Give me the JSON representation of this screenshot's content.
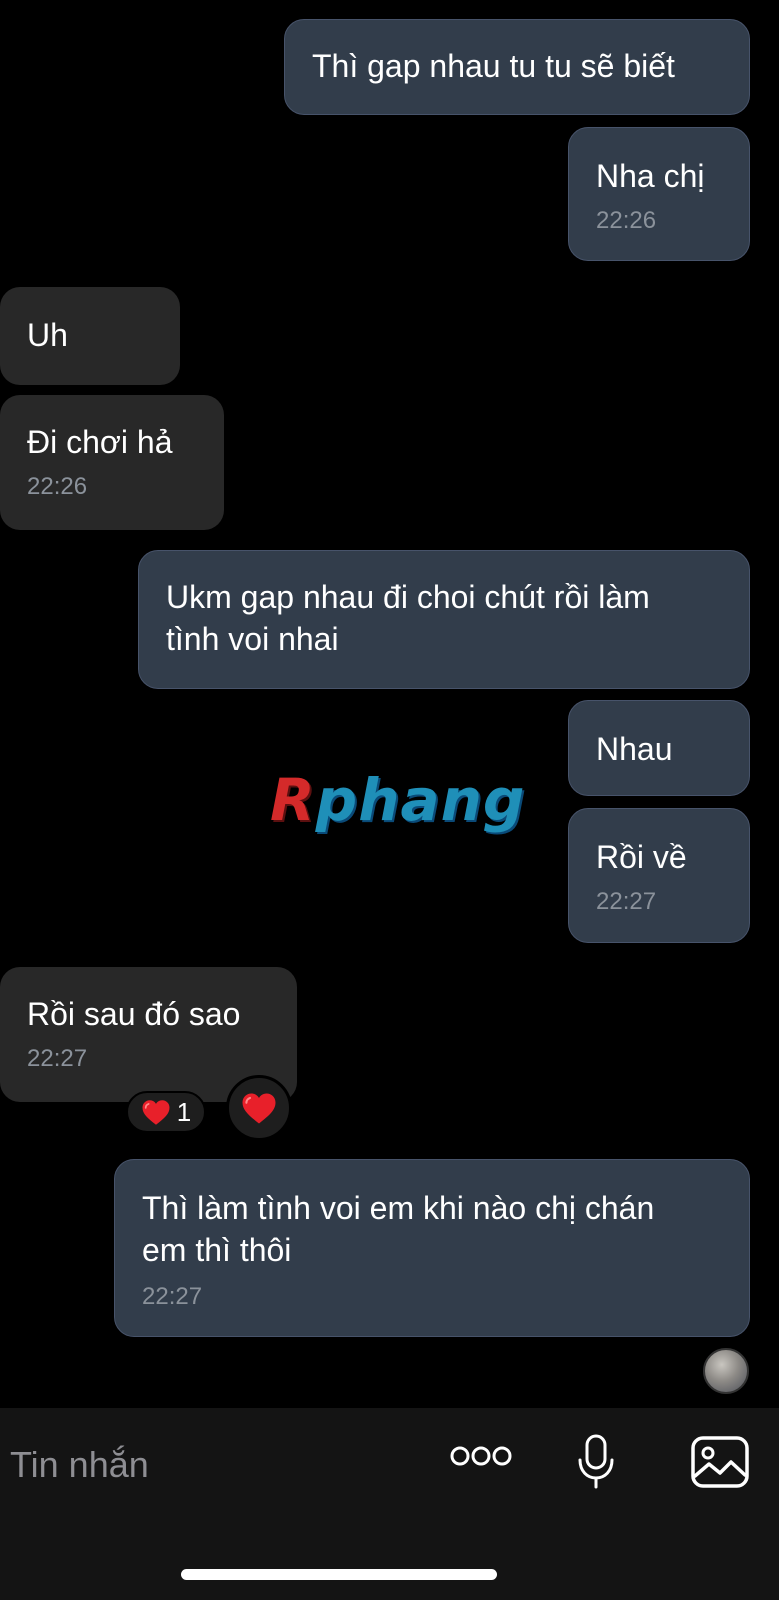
{
  "messages": [
    {
      "text": "Thì gap nhau tu tu sẽ biết"
    },
    {
      "text": "Nha chị",
      "time": "22:26"
    },
    {
      "text": "Uh"
    },
    {
      "text": "Đi chơi hả",
      "time": "22:26"
    },
    {
      "text": "Ukm gap nhau đi choi chút rồi làm\ntình voi nhai"
    },
    {
      "text": "Nhau"
    },
    {
      "text": "Rồi về",
      "time": "22:27"
    },
    {
      "text": "Rồi sau đó sao",
      "time": "22:27"
    },
    {
      "text": "Thì làm tình voi em khi nào chị chán\nem thì thôi",
      "time": "22:27"
    }
  ],
  "reaction": {
    "count": "1",
    "icon": "heart-icon",
    "color": "#e8202a"
  },
  "watermark": {
    "first": "R",
    "rest": "phang"
  },
  "composer": {
    "placeholder": "Tin nhắn",
    "icons": [
      "more-icon",
      "microphone-icon",
      "photo-icon"
    ]
  },
  "colors": {
    "outgoing_bubble": "#323d4b",
    "incoming_bubble": "#282828",
    "background": "#000000"
  }
}
